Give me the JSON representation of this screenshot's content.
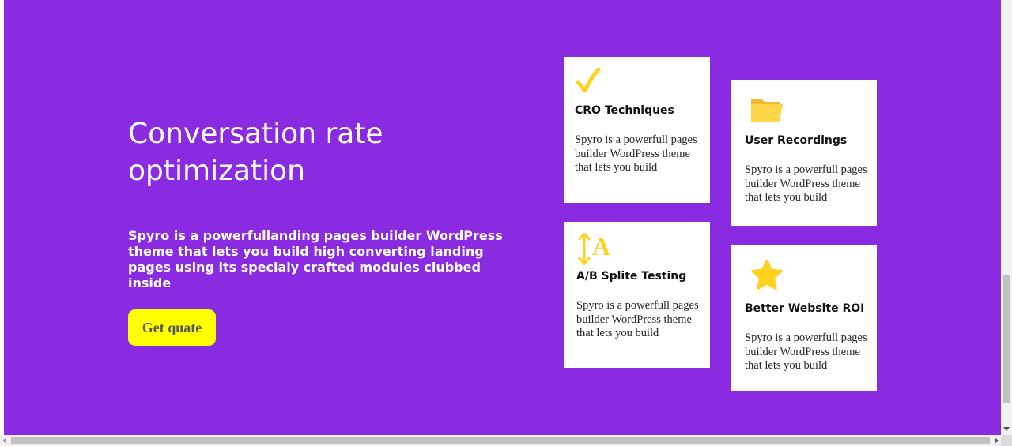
{
  "colors": {
    "background": "#8a2be2",
    "button": "#ffff00",
    "icon_accent": "#ffd21f",
    "card": "#ffffff"
  },
  "hero": {
    "title": "Conversation rate optimization",
    "description": "Spyro is a powerfullanding pages builder WordPress theme that lets you build high converting landing pages using its specialy crafted modules clubbed inside",
    "cta_label": "Get quate"
  },
  "features": [
    {
      "icon": "checkmark-icon",
      "title": "CRO Techniques",
      "text": "Spyro is a powerfull pages builder WordPress theme that lets you build"
    },
    {
      "icon": "folder-icon",
      "title": "User Recordings",
      "text": "Spyro is a powerfull pages builder WordPress theme that lets you build"
    },
    {
      "icon": "ab-testing-icon",
      "title": "A/B Splite Testing",
      "text": "Spyro is a powerfull pages builder WordPress theme that lets you build"
    },
    {
      "icon": "star-icon",
      "title": "Better Website ROI",
      "text": "Spyro is a powerfull pages builder WordPress theme that lets you build"
    }
  ]
}
